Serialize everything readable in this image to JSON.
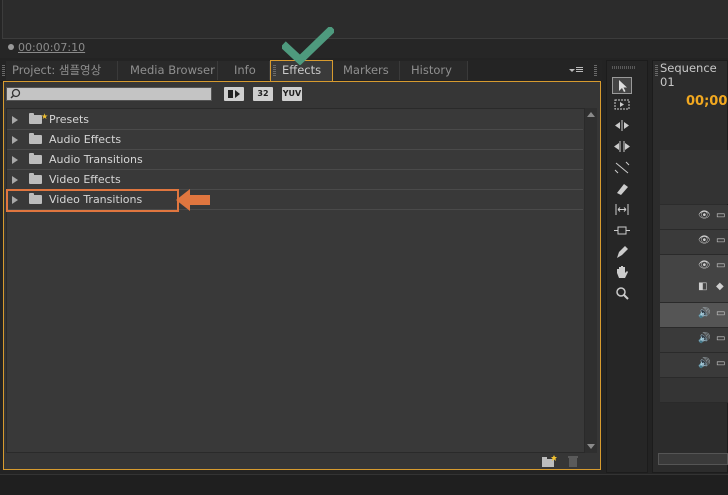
{
  "monitor": {
    "timecode": "00:00:07:10"
  },
  "tabs": [
    {
      "label": "Project: 샘플영상",
      "active": false
    },
    {
      "label": "Media Browser",
      "active": false
    },
    {
      "label": "Info",
      "active": false
    },
    {
      "label": "Effects",
      "active": true,
      "close": "×"
    },
    {
      "label": "Markers",
      "active": false
    },
    {
      "label": "History",
      "active": false
    }
  ],
  "effects": {
    "search_value": "",
    "filter_buttons": [
      "32",
      "YUV"
    ],
    "items": [
      {
        "label": "Presets"
      },
      {
        "label": "Audio Effects"
      },
      {
        "label": "Audio Transitions"
      },
      {
        "label": "Video Effects"
      },
      {
        "label": "Video Transitions"
      }
    ]
  },
  "sequence": {
    "tab_label": "Sequence 01",
    "timecode": "00;00;"
  },
  "colors": {
    "accent": "#d79b2f",
    "annotation_arrow": "#e0763f",
    "checkmark": "#4e9a7e",
    "timecode": "#f1a820"
  },
  "icons": [
    "checkmark-icon",
    "arrow-left-icon",
    "folder-icon",
    "search-icon",
    "panel-menu-icon",
    "new-bin-icon",
    "trash-icon",
    "selection-tool-icon",
    "hand-tool-icon",
    "zoom-tool-icon",
    "pen-tool-icon",
    "eye-icon",
    "speaker-icon"
  ]
}
